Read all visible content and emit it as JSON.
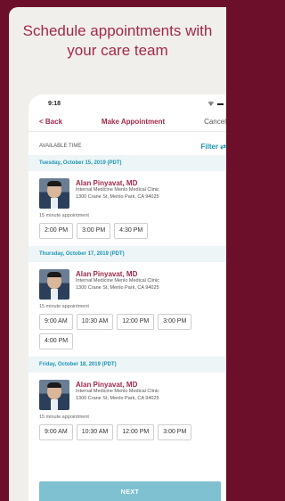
{
  "headline": "Schedule appointments with your care team",
  "status_bar": {
    "time": "9:18",
    "icons": "ᯤ ▬"
  },
  "nav": {
    "back_label": "< Back",
    "title": "Make Appointment",
    "cancel_label": "Cancel"
  },
  "section_label": "AVAILABLE TIME",
  "filter_label": "Filter ⇄",
  "days": [
    {
      "date": "Tuesday, October 15, 2019 (PDT)",
      "doctor": {
        "name": "Alan Pinyavat, MD",
        "clinic": "Internal Medicine Menlo Medical Clinic",
        "address": "1300 Crane St, Menlo Park, CA 94025"
      },
      "duration": "15 minute appointment",
      "slots": [
        "2:00 PM",
        "3:00 PM",
        "4:30 PM"
      ]
    },
    {
      "date": "Thursday, October 17, 2019 (PDT)",
      "doctor": {
        "name": "Alan Pinyavat, MD",
        "clinic": "Internal Medicine Menlo Medical Clinic",
        "address": "1300 Crane St, Menlo Park, CA 94025"
      },
      "duration": "15 minute appointment",
      "slots": [
        "9:00 AM",
        "10:30 AM",
        "12:00 PM",
        "3:00 PM",
        "4:00 PM"
      ]
    },
    {
      "date": "Friday, October 18, 2019 (PDT)",
      "doctor": {
        "name": "Alan Pinyavat, MD",
        "clinic": "Internal Medicine Menlo Medical Clinic",
        "address": "1300 Crane St, Menlo Park, CA 94025"
      },
      "duration": "15 minute appointment",
      "slots": [
        "9:00 AM",
        "10:30 AM",
        "12:00 PM",
        "3:00 PM"
      ]
    }
  ],
  "next_label": "NEXT",
  "colors": {
    "brand": "#a3294a",
    "accent": "#1b96b6",
    "background": "#6b0f2a"
  }
}
